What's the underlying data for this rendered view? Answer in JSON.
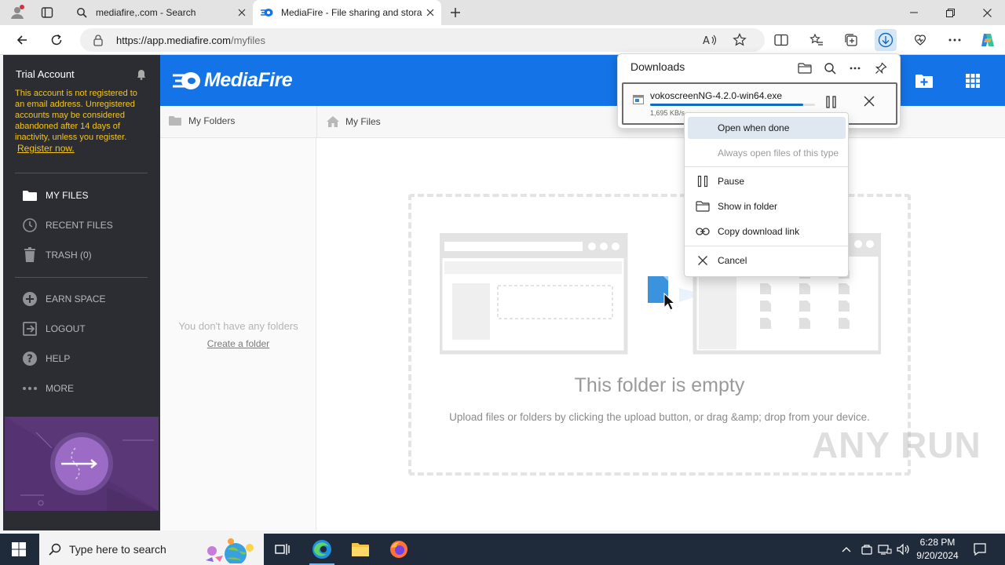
{
  "browser": {
    "tabs": [
      {
        "title": "mediafire,.com - Search",
        "icon": "search-icon"
      },
      {
        "title": "MediaFire - File sharing and stora",
        "icon": "mediafire-favicon"
      }
    ],
    "url_host": "https://app.mediafire.com",
    "url_path": "/myfiles",
    "accent": "#0f6cbd"
  },
  "sidebar": {
    "account_title": "Trial Account",
    "warning": "This account is not registered to an email address. Unregistered accounts may be considered abandoned after 14 days of inactivity, unless you register.",
    "register_link": "Register now.",
    "items": [
      {
        "label": "MY FILES",
        "icon": "folder-icon"
      },
      {
        "label": "RECENT FILES",
        "icon": "clock-icon"
      },
      {
        "label": "TRASH (0)",
        "icon": "trash-icon"
      },
      {
        "label": "EARN SPACE",
        "icon": "plus-circle-icon"
      },
      {
        "label": "LOGOUT",
        "icon": "logout-icon"
      },
      {
        "label": "HELP",
        "icon": "help-icon"
      },
      {
        "label": "MORE",
        "icon": "more-icon"
      }
    ]
  },
  "header": {
    "logo": "MediaFire",
    "brand_color": "#1473e6"
  },
  "folders": {
    "title": "My Folders",
    "empty": "You don't have any folders",
    "create": "Create a folder"
  },
  "main": {
    "breadcrumb": "My Files",
    "empty_title": "This folder is empty",
    "empty_sub": "Upload files or folders by clicking the upload button, or drag &amp; drop from your device."
  },
  "downloads": {
    "title": "Downloads",
    "file_name": "vokoscreenNG-4.2.0-win64.exe",
    "speed": "1,695 KB/s",
    "progress": 0.93
  },
  "context_menu": {
    "open_when_done": "Open when done",
    "always_open": "Always open files of this type",
    "pause": "Pause",
    "show_in_folder": "Show in folder",
    "copy_link": "Copy download link",
    "cancel": "Cancel"
  },
  "watermark": "ANY RUN",
  "taskbar": {
    "search_placeholder": "Type here to search",
    "time": "6:28 PM",
    "date": "9/20/2024"
  }
}
